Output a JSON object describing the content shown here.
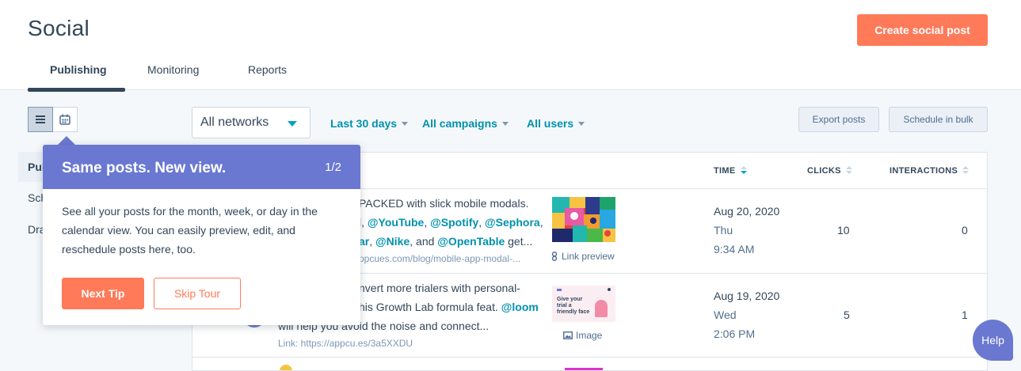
{
  "header": {
    "title": "Social",
    "create_label": "Create social post",
    "tabs": [
      {
        "label": "Publishing",
        "active": true
      },
      {
        "label": "Monitoring"
      },
      {
        "label": "Reports"
      }
    ]
  },
  "sidebar": {
    "items": [
      {
        "label": "Publ",
        "active": true
      },
      {
        "label": "Sch"
      },
      {
        "label": "Dra"
      }
    ]
  },
  "toolbar": {
    "network_value": "All networks",
    "filters": [
      "Last 30 days",
      "All campaigns",
      "All users"
    ],
    "export_label": "Export posts",
    "bulk_label": "Schedule in bulk"
  },
  "table": {
    "columns": [
      "TIME",
      "CLICKS",
      "INTERACTIONS"
    ],
    "rows": [
      {
        "line1": "PACKED with slick mobile modals.",
        "line2_prefix": "l, ",
        "m1": "@YouTube",
        "s1": ", ",
        "m2": "@Spotify",
        "s2": ", ",
        "m3": "@Sephora",
        "s3": ",",
        "line3_m1": "ar",
        "line3_s1": ", ",
        "line3_m2": "@Nike",
        "line3_s2": ", and ",
        "line3_m3": "@OpenTable",
        "line3_s3": " get...",
        "link": "ppcues.com/blog/mobile-app-modal-...",
        "media_label": "Link preview",
        "date": "Aug 20, 2020",
        "day": "Thu",
        "time": "9:34 AM",
        "clicks": "10",
        "interactions": "0"
      },
      {
        "line1": "nvert more trialers with personal-",
        "line2": "his Growth Lab formula feat. ",
        "line2_mention": "@loom",
        "line3": "will help you avoid the noise and connect...",
        "link": "Link: https://appcu.es/3a5XXDU",
        "media_label": "Image",
        "thumb_text": "Give your trial a friendly face",
        "date": "Aug 19, 2020",
        "day": "Wed",
        "time": "2:06 PM",
        "clicks": "5",
        "interactions": "1"
      }
    ]
  },
  "tooltip": {
    "title": "Same posts. New view.",
    "counter": "1/2",
    "body": "See all your posts for the month, week, or day in the calendar view. You can easily preview, edit, and reschedule posts here, too.",
    "next_label": "Next Tip",
    "skip_label": "Skip Tour"
  },
  "help": {
    "label": "Help"
  },
  "colors": {
    "accent_orange": "#ff7a59",
    "tooltip_purple": "#6a78d1",
    "link_teal": "#0091ae",
    "text_dark": "#33475b"
  }
}
